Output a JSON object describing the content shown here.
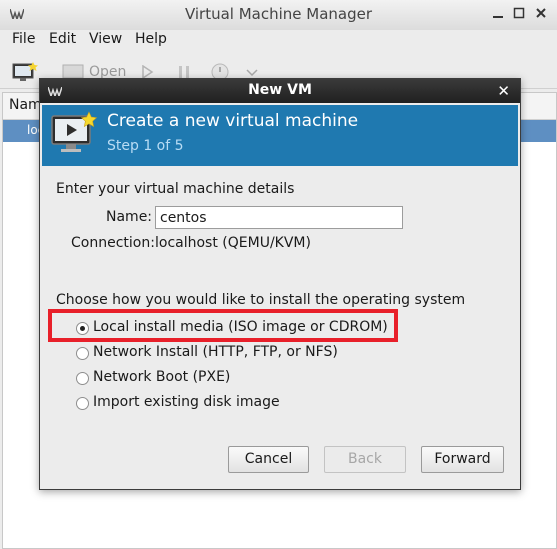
{
  "main_window": {
    "title": "Virtual Machine Manager",
    "menu": [
      "File",
      "Edit",
      "View",
      "Help"
    ],
    "toolbar": {
      "open_label": "Open"
    },
    "list_header": "Nam",
    "list_row_fragment": "loc"
  },
  "dialog": {
    "title": "New VM",
    "banner": {
      "title": "Create a new virtual machine",
      "step": "Step 1 of 5"
    },
    "details_heading": "Enter your virtual machine details",
    "name_label": "Name:",
    "name_value": "centos",
    "connection_label": "Connection:",
    "connection_value": "localhost (QEMU/KVM)",
    "install_heading": "Choose how you would like to install the operating system",
    "install_options": [
      {
        "label": "Local install media (ISO image or CDROM)",
        "selected": true
      },
      {
        "label": "Network Install (HTTP, FTP, or NFS)",
        "selected": false
      },
      {
        "label": "Network Boot (PXE)",
        "selected": false
      },
      {
        "label": "Import existing disk image",
        "selected": false
      }
    ],
    "buttons": {
      "cancel": "Cancel",
      "back": "Back",
      "forward": "Forward"
    }
  },
  "colors": {
    "banner": "#1f79b0",
    "highlight": "#e8202a",
    "selection": "#5e8fc2"
  }
}
